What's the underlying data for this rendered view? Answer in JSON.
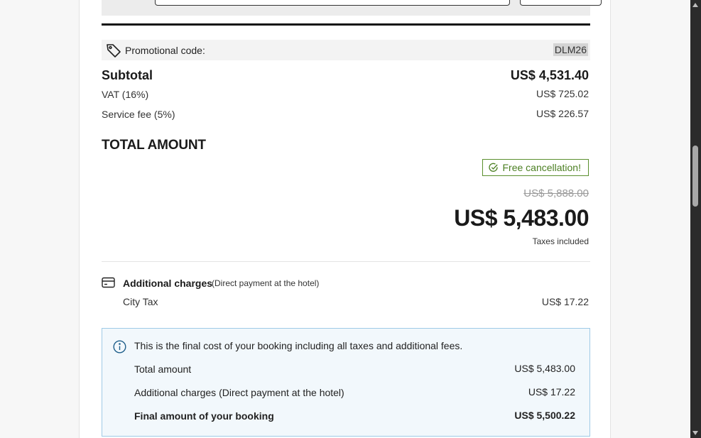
{
  "promo": {
    "label": "Promotional code:",
    "code": "DLM26",
    "icon": "tag-icon"
  },
  "subtotal": {
    "label": "Subtotal",
    "value": "US$ 4,531.40"
  },
  "vat": {
    "label": "VAT (16%)",
    "value": "US$ 725.02"
  },
  "service_fee": {
    "label": "Service fee (5%)",
    "value": "US$ 226.57"
  },
  "total": {
    "title": "TOTAL AMOUNT",
    "free_cancellation": "Free cancellation!",
    "old_price": "US$ 5,888.00",
    "price": "US$ 5,483.00",
    "taxes_note": "Taxes included"
  },
  "additional": {
    "title": "Additional charges",
    "subtitle": "(Direct payment at the hotel)",
    "icon": "credit-card-icon",
    "items": [
      {
        "label": "City Tax",
        "value": "US$ 17.22"
      }
    ]
  },
  "summary": {
    "note": "This is the final cost of your booking including all taxes and additional fees.",
    "rows": [
      {
        "label": "Total amount",
        "value": "US$ 5,483.00"
      },
      {
        "label": "Additional charges (Direct payment at the hotel)",
        "value": "US$ 17.22"
      },
      {
        "label": "Final amount of your booking",
        "value": "US$ 5,500.22"
      }
    ]
  },
  "colors": {
    "accent_green": "#4b7f22",
    "info_border": "#9fcbe6",
    "info_bg": "#f2f8fc"
  }
}
